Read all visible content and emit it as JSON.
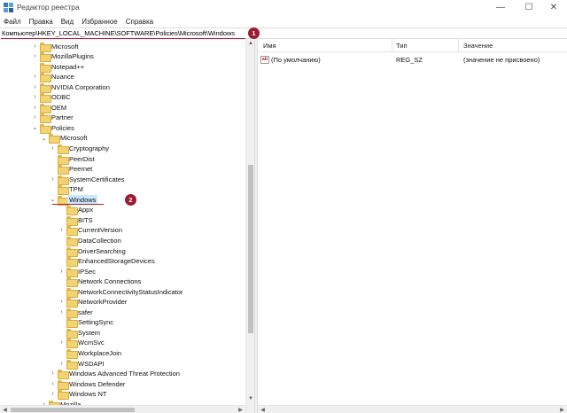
{
  "window": {
    "title": "Редактор реестра",
    "minimize_glyph": "—",
    "maximize_glyph": "☐",
    "close_glyph": "✕",
    "icon": "registry-editor-icon"
  },
  "menu": [
    "Файл",
    "Правка",
    "Вид",
    "Избранное",
    "Справка"
  ],
  "address": {
    "path": "Компьютер\\HKEY_LOCAL_MACHINE\\SOFTWARE\\Policies\\Microsoft\\Windows"
  },
  "badges": {
    "first": "1",
    "second": "2"
  },
  "tree": [
    {
      "label": "Microsoft",
      "depth": 0,
      "expander": "›"
    },
    {
      "label": "MozillaPlugins",
      "depth": 0,
      "expander": "›"
    },
    {
      "label": "Notepad++",
      "depth": 0,
      "expander": ""
    },
    {
      "label": "Nuance",
      "depth": 0,
      "expander": "›"
    },
    {
      "label": "NVIDIA Corporation",
      "depth": 0,
      "expander": "›"
    },
    {
      "label": "ODBC",
      "depth": 0,
      "expander": "›"
    },
    {
      "label": "OEM",
      "depth": 0,
      "expander": "›"
    },
    {
      "label": "Partner",
      "depth": 0,
      "expander": "›"
    },
    {
      "label": "Policies",
      "depth": 0,
      "expander": "⌄"
    },
    {
      "label": "Microsoft",
      "depth": 1,
      "expander": "⌄"
    },
    {
      "label": "Cryptography",
      "depth": 2,
      "expander": "›"
    },
    {
      "label": "PeerDist",
      "depth": 2,
      "expander": ""
    },
    {
      "label": "Peernet",
      "depth": 2,
      "expander": ""
    },
    {
      "label": "SystemCertificates",
      "depth": 2,
      "expander": "›"
    },
    {
      "label": "TPM",
      "depth": 2,
      "expander": ""
    },
    {
      "label": "Windows",
      "depth": 2,
      "expander": "⌄",
      "selected": true
    },
    {
      "label": "Appx",
      "depth": 3,
      "expander": ""
    },
    {
      "label": "BITS",
      "depth": 3,
      "expander": ""
    },
    {
      "label": "CurrentVersion",
      "depth": 3,
      "expander": "›"
    },
    {
      "label": "DataCollection",
      "depth": 3,
      "expander": ""
    },
    {
      "label": "DriverSearching",
      "depth": 3,
      "expander": ""
    },
    {
      "label": "EnhancedStorageDevices",
      "depth": 3,
      "expander": ""
    },
    {
      "label": "IPSec",
      "depth": 3,
      "expander": "›"
    },
    {
      "label": "Network Connections",
      "depth": 3,
      "expander": ""
    },
    {
      "label": "NetworkConnectivityStatusIndicator",
      "depth": 3,
      "expander": ""
    },
    {
      "label": "NetworkProvider",
      "depth": 3,
      "expander": "›"
    },
    {
      "label": "safer",
      "depth": 3,
      "expander": "›"
    },
    {
      "label": "SettingSync",
      "depth": 3,
      "expander": ""
    },
    {
      "label": "System",
      "depth": 3,
      "expander": ""
    },
    {
      "label": "WcmSvc",
      "depth": 3,
      "expander": "›"
    },
    {
      "label": "WorkplaceJoin",
      "depth": 3,
      "expander": ""
    },
    {
      "label": "WSDAPI",
      "depth": 3,
      "expander": "›"
    },
    {
      "label": "Windows Advanced Threat Protection",
      "depth": 2,
      "expander": "›"
    },
    {
      "label": "Windows Defender",
      "depth": 2,
      "expander": "›"
    },
    {
      "label": "Windows NT",
      "depth": 2,
      "expander": "›"
    },
    {
      "label": "Mozilla",
      "depth": 1,
      "expander": "›"
    }
  ],
  "list": {
    "columns": [
      "Имя",
      "Тип",
      "Значение"
    ],
    "rows": [
      {
        "name": "(По умолчанию)",
        "type": "REG_SZ",
        "value": "(значение не присвоено)",
        "icon": "string-value-icon",
        "icon_text": "ab"
      }
    ]
  },
  "colors": {
    "accent_red": "#9b1b30",
    "selection": "#cce8ff",
    "folder": "#f3d271"
  }
}
